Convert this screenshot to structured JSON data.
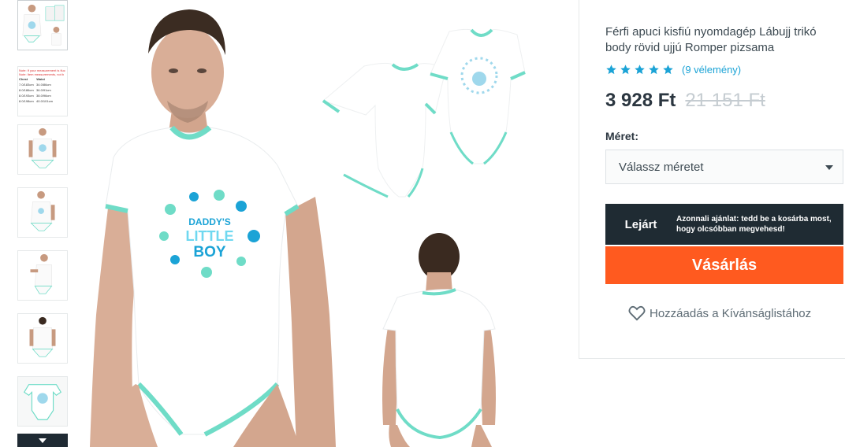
{
  "thumbnails": [
    {
      "name": "thumb-front-back-combo",
      "active": true
    },
    {
      "name": "thumb-size-chart",
      "note1": "Note: If your measurement is fluc",
      "note2": "Note: Item measurements, not b",
      "header_chest": "Chest",
      "header_waist": "Waist",
      "rows": [
        [
          "7.0/183cm",
          "34.0/86cm"
        ],
        [
          "8.0/186cm",
          "36.0/91cm"
        ],
        [
          "8.0/193cm",
          "38.0/96cm"
        ],
        [
          "8.0/198cm",
          "40.0/101cm"
        ]
      ]
    },
    {
      "name": "thumb-front-full"
    },
    {
      "name": "thumb-front-side"
    },
    {
      "name": "thumb-side"
    },
    {
      "name": "thumb-back"
    },
    {
      "name": "thumb-flat-lay"
    }
  ],
  "product": {
    "title": "Férfi apuci kisfiú nyomdagép Lábujj trikó body rövid ujjú Romper pizsama",
    "stars": 5,
    "reviews": "(9 vélemény)",
    "price": "3 928 Ft",
    "old_price": "21 151 Ft",
    "size_label": "Méret:",
    "size_placeholder": "Válassz méretet",
    "promo_left": "Lejárt",
    "promo_right": "Azonnali ajánlat: tedd be a kosárba most, hogy olcsóbban megvehesd!",
    "buy_label": "Vásárlás",
    "wishlist_label": "Hozzáadás a Kívánságlistához"
  },
  "print": {
    "line1": "DADDY'S",
    "line2": "LITTLE",
    "line3": "BOY"
  },
  "colors": {
    "accent_orange": "#ff5a1f",
    "star_blue": "#1ba3d6",
    "promo_dark": "#1f2b33",
    "trim_mint": "#6fdcc7"
  }
}
